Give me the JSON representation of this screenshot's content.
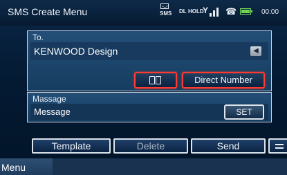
{
  "header": {
    "title": "SMS Create Menu",
    "status": {
      "sms": "SMS",
      "dl": "DL",
      "hold": "HOLD",
      "clock": "00:00"
    }
  },
  "to_section": {
    "label": "To.",
    "recipient": "KENWOOD Design",
    "phonebook_icon": "phonebook-icon",
    "direct_number_label": "Direct Number"
  },
  "message_section": {
    "label": "Massage",
    "value": "Message",
    "set_label": "SET"
  },
  "actions": {
    "template_label": "Template",
    "delete_label": "Delete",
    "send_label": "Send"
  },
  "footer": {
    "menu_label": "Menu"
  },
  "colors": {
    "highlight_border": "#ff3b2e",
    "battery": "#6fd64f",
    "background": "#082341"
  }
}
